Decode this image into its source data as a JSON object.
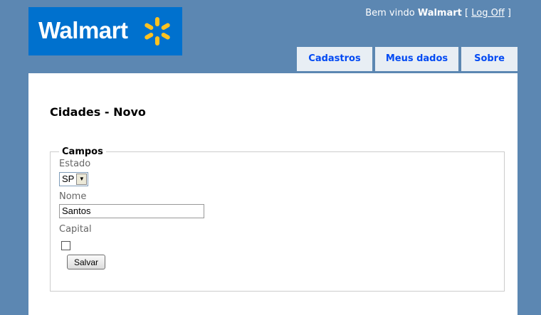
{
  "header": {
    "logo_text": "Walmart",
    "welcome_text": "Bem vindo",
    "user_name": "Walmart",
    "bracket_open": "[",
    "logoff_label": "Log Off",
    "bracket_close": "]"
  },
  "tabs": [
    {
      "label": "Cadastros"
    },
    {
      "label": "Meus dados"
    },
    {
      "label": "Sobre"
    }
  ],
  "main": {
    "title": "Cidades - Novo",
    "fieldset_legend": "Campos",
    "fields": {
      "estado_label": "Estado",
      "estado_value": "SP",
      "nome_label": "Nome",
      "nome_value": "Santos",
      "capital_label": "Capital",
      "capital_checked": false
    },
    "save_label": "Salvar"
  },
  "colors": {
    "page_background": "#5c87b2",
    "logo_background": "#0071ce",
    "logo_spark": "#ffc220",
    "tab_text": "#034af3",
    "tab_background": "#e8eef4"
  }
}
